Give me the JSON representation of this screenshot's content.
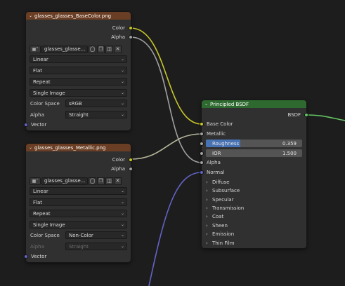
{
  "colors": {
    "color_socket": "#c7c729",
    "float_socket": "#a1a1a1",
    "vector_socket": "#6363c7",
    "shader_socket": "#63c763",
    "texture_header": "#6a3e24",
    "shader_header": "#2e6a2f",
    "value_fill": "#4772b3"
  },
  "node1": {
    "title": "glasses_glasses_BaseColor.png",
    "out_color": "Color",
    "out_alpha": "Alpha",
    "image_name": "glasses_glasse...",
    "interpolation": "Linear",
    "projection": "Flat",
    "extension": "Repeat",
    "source": "Single Image",
    "color_space_label": "Color Space",
    "color_space": "sRGB",
    "alpha_label": "Alpha",
    "alpha_mode": "Straight",
    "in_vector": "Vector"
  },
  "node2": {
    "title": "glasses_glasses_Metallic.png",
    "out_color": "Color",
    "out_alpha": "Alpha",
    "image_name": "glasses_glasse...",
    "interpolation": "Linear",
    "projection": "Flat",
    "extension": "Repeat",
    "source": "Single Image",
    "color_space_label": "Color Space",
    "color_space": "Non-Color",
    "alpha_label": "Alpha",
    "alpha_mode": "Straight",
    "in_vector": "Vector"
  },
  "bsdf": {
    "title": "Principled BSDF",
    "out_bsdf": "BSDF",
    "base_color": "Base Color",
    "metallic": "Metallic",
    "roughness_label": "Roughness",
    "roughness_value": "0.359",
    "roughness_fraction": 0.359,
    "ior_label": "IOR",
    "ior_value": "1.500",
    "alpha": "Alpha",
    "normal": "Normal",
    "panels": [
      "Diffuse",
      "Subsurface",
      "Specular",
      "Transmission",
      "Coat",
      "Sheen",
      "Emission",
      "Thin Film"
    ]
  }
}
